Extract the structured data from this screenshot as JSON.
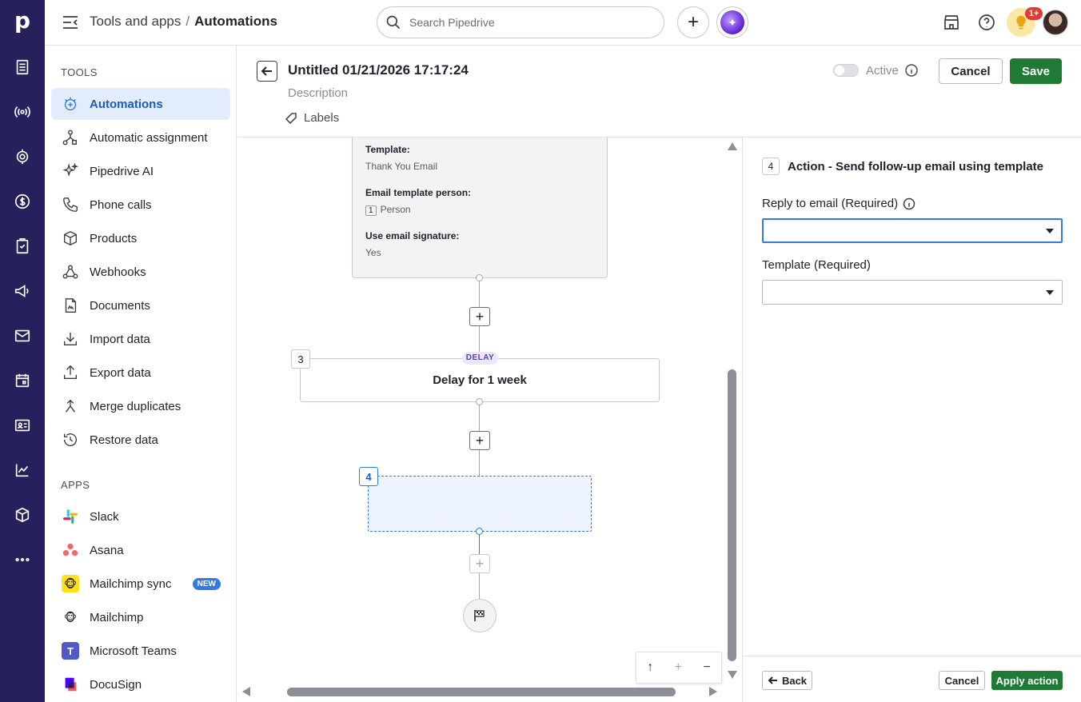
{
  "app": {
    "logo": "p",
    "breadcrumb": {
      "parent": "Tools and apps",
      "separator": "/",
      "current": "Automations"
    },
    "search_placeholder": "Search Pipedrive",
    "notification_badge": "1+"
  },
  "rail_icons": [
    "deals-icon",
    "leads-icon",
    "focus-icon",
    "money-icon",
    "activities-icon",
    "campaigns-icon",
    "mail-icon",
    "calendar-icon",
    "contacts-icon",
    "insights-icon",
    "products-icon",
    "more-icon"
  ],
  "sidebar": {
    "tools_title": "TOOLS",
    "tools": [
      {
        "label": "Automations",
        "icon": "automations-icon",
        "active": true
      },
      {
        "label": "Automatic assignment",
        "icon": "assignment-icon"
      },
      {
        "label": "Pipedrive AI",
        "icon": "sparkle-icon"
      },
      {
        "label": "Phone calls",
        "icon": "phone-icon"
      },
      {
        "label": "Products",
        "icon": "box-icon"
      },
      {
        "label": "Webhooks",
        "icon": "webhook-icon"
      },
      {
        "label": "Documents",
        "icon": "document-icon"
      },
      {
        "label": "Import data",
        "icon": "import-icon"
      },
      {
        "label": "Export data",
        "icon": "export-icon"
      },
      {
        "label": "Merge duplicates",
        "icon": "merge-icon"
      },
      {
        "label": "Restore data",
        "icon": "restore-icon"
      }
    ],
    "apps_title": "APPS",
    "apps": [
      {
        "label": "Slack",
        "icon": "slack-icon"
      },
      {
        "label": "Asana",
        "icon": "asana-icon"
      },
      {
        "label": "Mailchimp sync",
        "icon": "mailchimp-icon",
        "badge": "NEW"
      },
      {
        "label": "Mailchimp",
        "icon": "mailchimp-icon"
      },
      {
        "label": "Microsoft Teams",
        "icon": "teams-icon"
      },
      {
        "label": "DocuSign",
        "icon": "docusign-icon"
      }
    ]
  },
  "header": {
    "title": "Untitled 01/21/2026 17:17:24",
    "description": "Description",
    "labels": "Labels",
    "active_label": "Active",
    "active": false,
    "cancel": "Cancel",
    "save": "Save"
  },
  "canvas": {
    "step2": {
      "template_key": "Template:",
      "template_value": "Thank You Email",
      "person_key": "Email template person:",
      "person_num": "1",
      "person_value": "Person",
      "signature_key": "Use email signature:",
      "signature_value": "Yes"
    },
    "step3": {
      "num": "3",
      "tag": "DELAY",
      "text": "Delay for 1 week"
    },
    "step4": {
      "num": "4"
    },
    "add": "+",
    "zoom": {
      "up": "↑",
      "in": "+",
      "out": "−"
    }
  },
  "panel": {
    "num": "4",
    "title": "Action - Send follow-up email using template",
    "reply_label": "Reply to email (Required)",
    "reply_value": "",
    "template_label": "Template (Required)",
    "template_value": "",
    "back": "Back",
    "cancel": "Cancel",
    "apply": "Apply action"
  },
  "colors": {
    "rail": "#26215c",
    "accent": "#317ae2",
    "save": "#1e7a34"
  }
}
